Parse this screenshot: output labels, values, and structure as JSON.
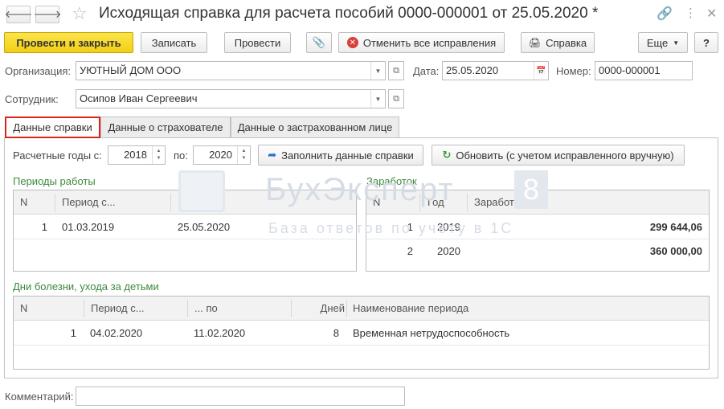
{
  "window": {
    "title": "Исходящая справка для расчета пособий 0000-000001 от 25.05.2020 *",
    "back_icon": "arrow-left-icon",
    "forward_icon": "arrow-right-icon",
    "favorite_icon": "star-icon",
    "link_icon": "link-icon",
    "menu_icon": "more-vertical-icon",
    "close_icon": "close-icon"
  },
  "toolbar": {
    "post_close": "Провести и закрыть",
    "save": "Записать",
    "post": "Провести",
    "attach_icon": "paperclip-icon",
    "cancel_corrections": "Отменить все исправления",
    "print": "Справка",
    "more": "Еще",
    "help": "?"
  },
  "header": {
    "org_label": "Организация:",
    "org_value": "УЮТНЫЙ ДОМ ООО",
    "date_label": "Дата:",
    "date_value": "25.05.2020",
    "number_label": "Номер:",
    "number_value": "0000-000001",
    "employee_label": "Сотрудник:",
    "employee_value": "Осипов Иван Сергеевич"
  },
  "tabs": [
    {
      "label": "Данные справки",
      "active": true
    },
    {
      "label": "Данные о страхователе",
      "active": false
    },
    {
      "label": "Данные о застрахованном лице",
      "active": false
    }
  ],
  "years": {
    "from_label": "Расчетные годы с:",
    "from_value": "2018",
    "to_label": "по:",
    "to_value": "2020",
    "fill_button": "Заполнить данные справки",
    "refresh_button": "Обновить (с учетом исправленного вручную)"
  },
  "work_periods": {
    "title": "Периоды работы",
    "columns": [
      "N",
      "Период с...",
      "... по"
    ],
    "rows": [
      [
        "1",
        "01.03.2019",
        "25.05.2020"
      ]
    ]
  },
  "earnings": {
    "title": "Заработок",
    "columns": [
      "N",
      "Год",
      "Заработок"
    ],
    "rows": [
      [
        "1",
        "2019",
        "299 644,06"
      ],
      [
        "2",
        "2020",
        "360 000,00"
      ]
    ]
  },
  "sick_days": {
    "title": "Дни болезни, ухода за детьми",
    "columns": [
      "N",
      "Период с...",
      "... по",
      "Дней",
      "Наименование периода"
    ],
    "rows": [
      [
        "1",
        "04.02.2020",
        "11.02.2020",
        "8",
        "Временная нетрудоспособность"
      ]
    ]
  },
  "comment": {
    "label": "Комментарий:",
    "value": ""
  },
  "watermark": {
    "brand": "БухЭксперт",
    "number": "8",
    "tagline": "База ответов по учёту в 1С"
  }
}
